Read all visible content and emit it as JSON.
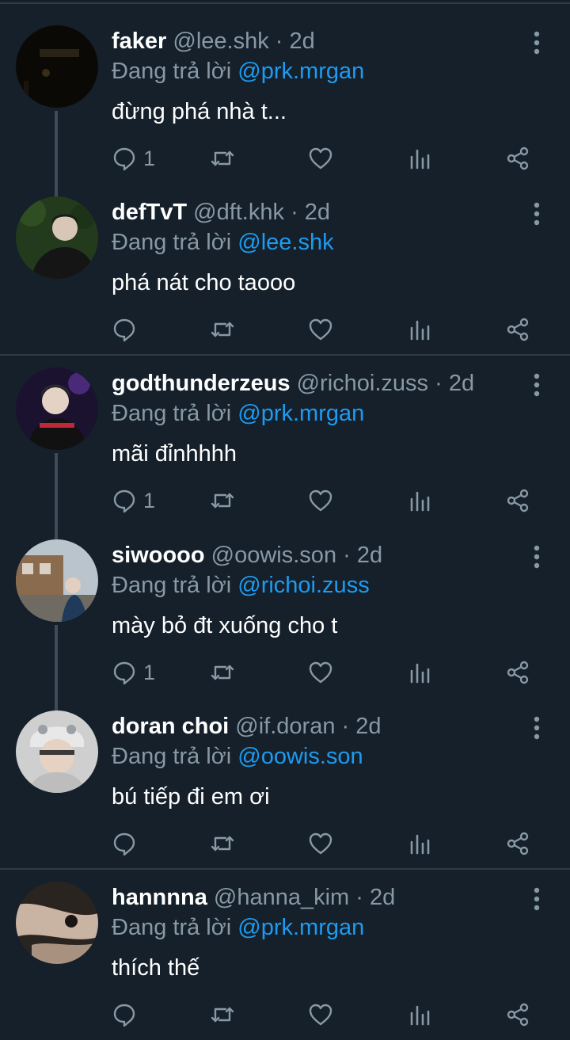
{
  "reply_prefix": "Đang trả lời",
  "colors": {
    "background": "#15202b",
    "secondary": "#8899a6",
    "accent": "#1d9bf0"
  },
  "icons": [
    "more-vertical-icon",
    "reply-icon",
    "retweet-icon",
    "like-icon",
    "analytics-icon",
    "share-icon"
  ],
  "tweets": [
    {
      "name": "faker",
      "handle": "@lee.shk",
      "time": "· 2d",
      "reply_to": "@prk.mrgan",
      "text": "đừng phá nhà t...",
      "reply_count": "1"
    },
    {
      "name": "defTvT",
      "handle": "@dft.khk",
      "time": "· 2d",
      "reply_to": "@lee.shk",
      "text": "phá nát cho taooo",
      "reply_count": ""
    },
    {
      "name": "godthunderzeus",
      "handle": "@richoi.zuss",
      "time": "· 2d",
      "reply_to": "@prk.mrgan",
      "text": "mãi đỉnhhhh",
      "reply_count": "1"
    },
    {
      "name": "siwoooo",
      "handle": "@oowis.son",
      "time": "· 2d",
      "reply_to": "@richoi.zuss",
      "text": "mày bỏ đt xuống cho t",
      "reply_count": "1"
    },
    {
      "name": "doran choi",
      "handle": "@if.doran",
      "time": "· 2d",
      "reply_to": "@oowis.son",
      "text": "bú tiếp đi em ơi",
      "reply_count": ""
    },
    {
      "name": "hannnna",
      "handle": "@hanna_kim",
      "time": "· 2d",
      "reply_to": "@prk.mrgan",
      "text": "thích thế",
      "reply_count": ""
    }
  ]
}
